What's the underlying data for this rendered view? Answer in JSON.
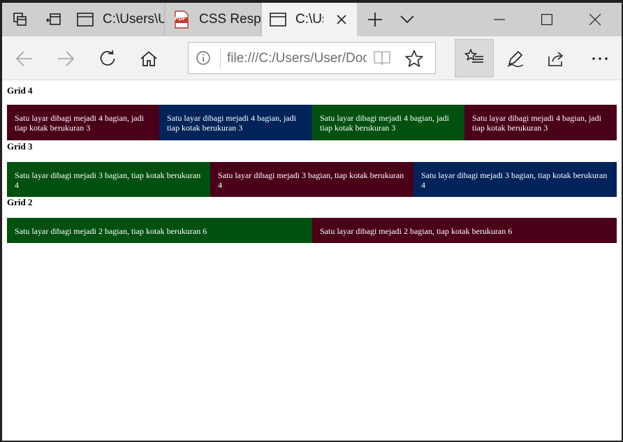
{
  "browser": {
    "tabs": [
      {
        "title": "C:\\Users\\User\\Documents",
        "icon": "page-icon",
        "active": false
      },
      {
        "title": "CSS Responsive Grid",
        "icon": "pdf-icon",
        "active": false
      },
      {
        "title": "C:\\Users\\User\\Documents",
        "icon": "page-icon",
        "active": true
      }
    ],
    "pdf_icon_label": "PDF",
    "address": {
      "url": "file:///C:/Users/User/Documents"
    }
  },
  "page": {
    "sections": [
      {
        "heading": "Grid 4",
        "cells": [
          {
            "text": "Satu layar dibagi mejadi 4 bagian, jadi tiap kotak berukuran 3",
            "color": "#4b0019"
          },
          {
            "text": "Satu layar dibagi mejadi 4 bagian, jadi tiap kotak berukuran 3",
            "color": "#00235a"
          },
          {
            "text": "Satu layar dibagi mejadi 4 bagian, jadi tiap kotak berukuran 3",
            "color": "#00510f"
          },
          {
            "text": "Satu layar dibagi mejadi 4 bagian, jadi tiap kotak berukuran 3",
            "color": "#4b0019"
          }
        ]
      },
      {
        "heading": "Grid 3",
        "cells": [
          {
            "text": "Satu layar dibagi mejadi 3 bagian, tiap kotak berukuran 4",
            "color": "#00510f"
          },
          {
            "text": "Satu layar dibagi mejadi 3 bagian, tiap kotak berukuran 4",
            "color": "#4b0019"
          },
          {
            "text": "Satu layar dibagi mejadi 3 bagian, tiap kotak berukuran 4",
            "color": "#00235a"
          }
        ]
      },
      {
        "heading": "Grid 2",
        "cells": [
          {
            "text": "Satu layar dibagi mejadi 2 bagian, tiap kotak berukuran 6",
            "color": "#00510f"
          },
          {
            "text": "Satu layar dibagi mejadi 2 bagian, tiap kotak berukuran 6",
            "color": "#4b0019"
          }
        ]
      }
    ]
  }
}
